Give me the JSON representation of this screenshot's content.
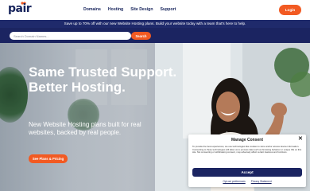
{
  "header": {
    "logo_text": "pair",
    "nav": [
      {
        "label": "Domains"
      },
      {
        "label": "Hosting"
      },
      {
        "label": "Site Design"
      },
      {
        "label": "Support"
      }
    ],
    "login_label": "Login"
  },
  "promo": {
    "text": "Save up to 70% off with our new Website Hosting plans. Build your website today with a team that's here to help."
  },
  "search": {
    "placeholder": "Search Domain Names...",
    "button_label": "Search"
  },
  "hero": {
    "title": "Same Trusted Support. Better Hosting.",
    "subtitle": "New Website Hosting plans built for real websites, backed by real people.",
    "cta_label": "See Plans & Pricing"
  },
  "consent": {
    "title": "Manage Consent",
    "body": "To provide the best experiences, we use technologies like cookies to store and/or access device information. Consenting to these technologies will allow us to process data such as browsing behavior or unique IDs on this site. Not consenting or withdrawing consent, may adversely affect certain features and functions.",
    "accept_label": "Accept",
    "links": [
      {
        "label": "Opt-out preferences"
      },
      {
        "label": "Privacy Statement"
      }
    ]
  },
  "colors": {
    "brand_navy": "#1b2461",
    "accent_orange": "#f25a22"
  }
}
